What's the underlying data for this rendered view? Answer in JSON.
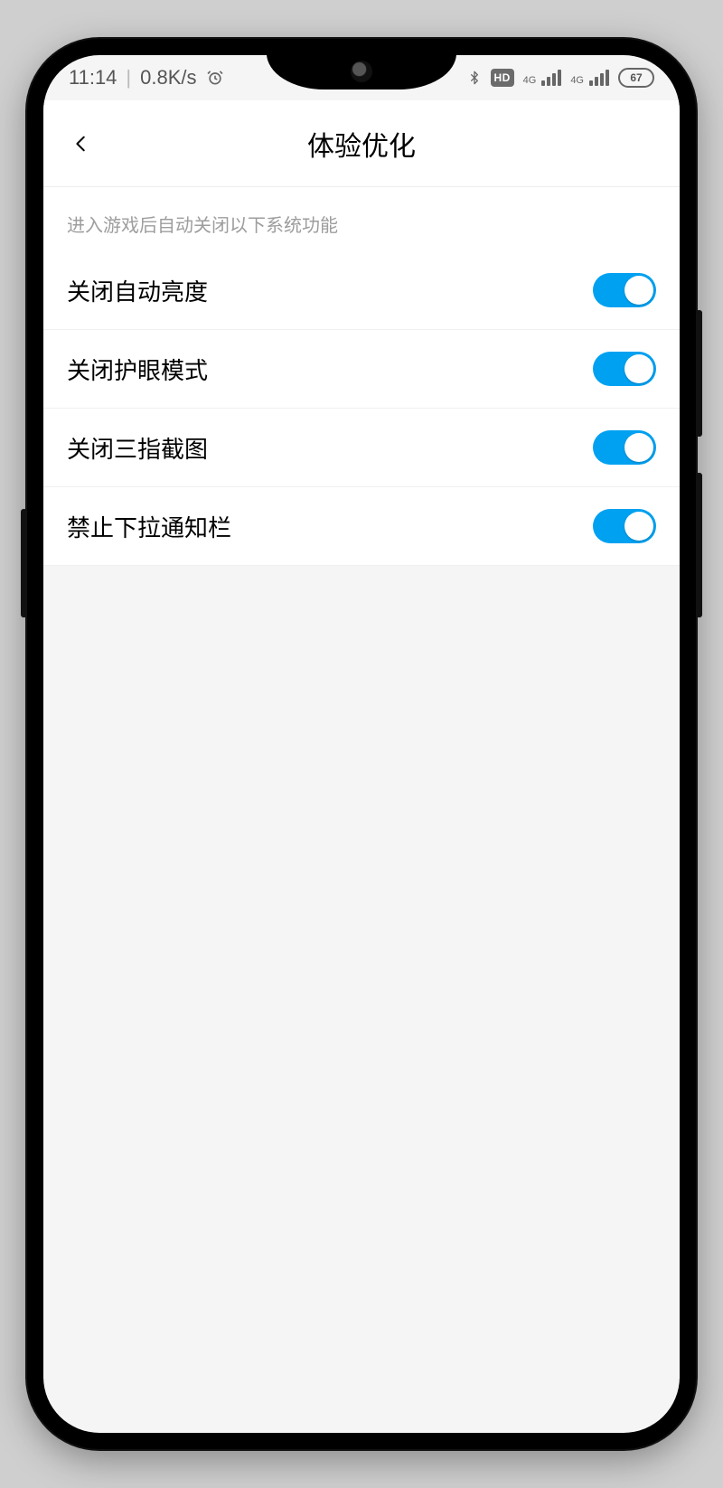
{
  "status": {
    "time": "11:14",
    "net_speed": "0.8K/s",
    "hd_label": "HD",
    "sig1_label": "4G",
    "sig2_label": "4G",
    "battery_pct": "67"
  },
  "header": {
    "title": "体验优化"
  },
  "section": {
    "description": "进入游戏后自动关闭以下系统功能"
  },
  "settings": [
    {
      "label": "关闭自动亮度",
      "on": true
    },
    {
      "label": "关闭护眼模式",
      "on": true
    },
    {
      "label": "关闭三指截图",
      "on": true
    },
    {
      "label": "禁止下拉通知栏",
      "on": true
    }
  ],
  "colors": {
    "accent": "#00a1f1"
  }
}
